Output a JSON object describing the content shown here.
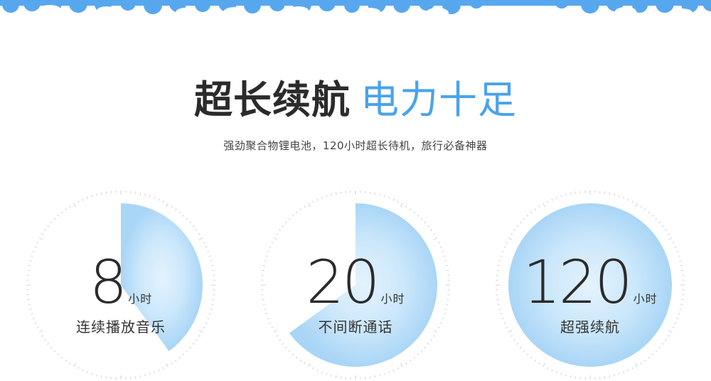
{
  "headline": {
    "bold": "超长续航",
    "light": "电力十足"
  },
  "subtitle": "强劲聚合物锂电池，120小时超长待机，旅行必备神器",
  "stats": [
    {
      "number": "8",
      "unit": "小时",
      "label": "连续播放音乐",
      "fill_fraction": 0.4
    },
    {
      "number": "20",
      "unit": "小时",
      "label": "不间断通话",
      "fill_fraction": 0.65
    },
    {
      "number": "120",
      "unit": "小时",
      "label": "超强续航",
      "fill_fraction": 1.0
    }
  ],
  "colors": {
    "sky_blue": "#57a7ef",
    "accent": "#4aa3ea",
    "fill_light": "#e4f3fd",
    "fill_dark": "#a9d5f6"
  }
}
